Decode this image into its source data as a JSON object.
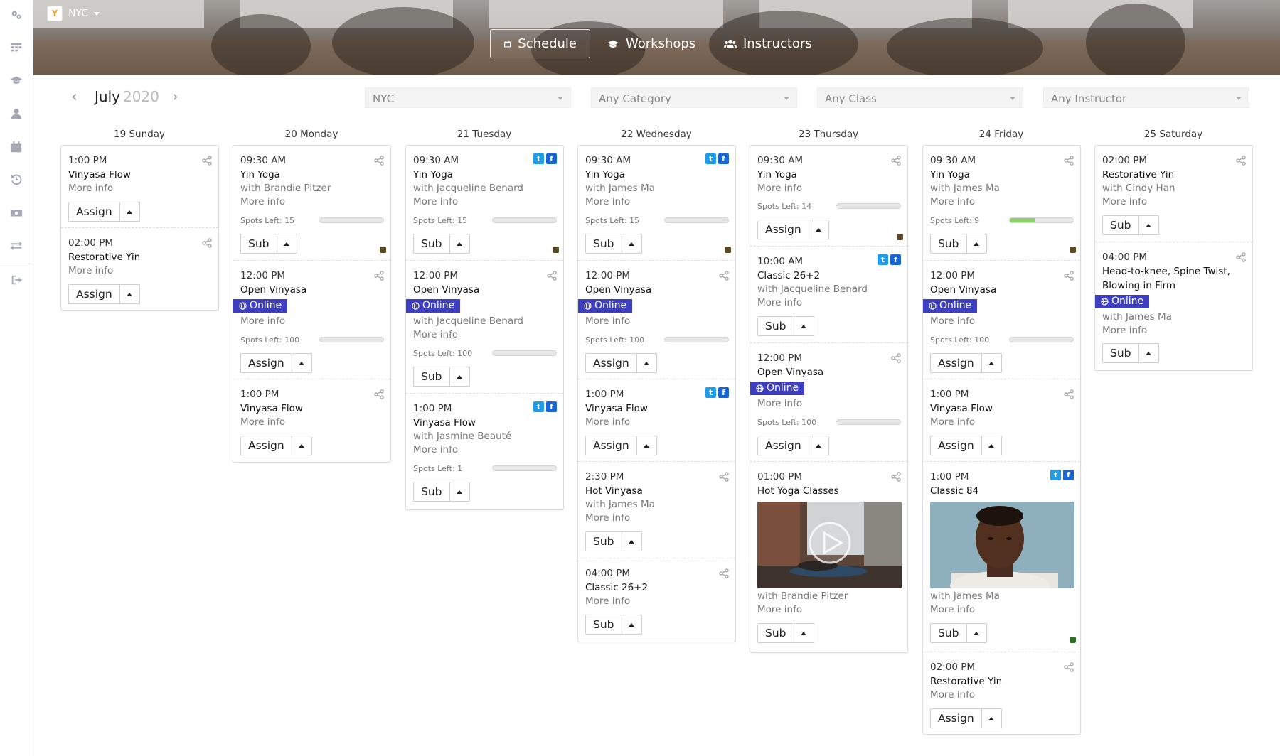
{
  "app": {
    "location": "NYC",
    "logo_text": "Y"
  },
  "nav": {
    "schedule": "Schedule",
    "workshops": "Workshops",
    "instructors": "Instructors"
  },
  "calendar": {
    "month": "July",
    "year": "2020",
    "prev": "‹",
    "next": "›"
  },
  "filters": {
    "location": "NYC",
    "category": "Any Category",
    "class": "Any Class",
    "instructor": "Any Instructor"
  },
  "days": [
    {
      "label": "19 Sunday",
      "classes": [
        {
          "time": "1:00 PM",
          "title": "Vinyasa Flow",
          "more": "More info",
          "action": "Assign"
        },
        {
          "time": "02:00 PM",
          "title": "Restorative Yin",
          "more": "More info",
          "action": "Assign"
        }
      ]
    },
    {
      "label": "20 Monday",
      "classes": [
        {
          "time": "09:30 AM",
          "title": "Yin Yoga",
          "instructor": "with Brandie Pitzer",
          "more": "More info",
          "spots": "Spots Left: 15",
          "spots_fill": 0,
          "action": "Sub"
        },
        {
          "time": "12:00 PM",
          "title": "Open Vinyasa",
          "online": "Online",
          "more": "More info",
          "spots": "Spots Left: 100",
          "spots_fill": 0,
          "action": "Assign"
        },
        {
          "time": "1:00 PM",
          "title": "Vinyasa Flow",
          "more": "More info",
          "action": "Assign"
        }
      ]
    },
    {
      "label": "21 Tuesday",
      "classes": [
        {
          "time": "09:30 AM",
          "title": "Yin Yoga",
          "instructor": "with Jacqueline Benard",
          "more": "More info",
          "spots": "Spots Left: 15",
          "spots_fill": 0,
          "action": "Sub"
        },
        {
          "time": "12:00 PM",
          "title": "Open Vinyasa",
          "online": "Online",
          "instructor": "with Jacqueline Benard",
          "more": "More info",
          "spots": "Spots Left: 100",
          "spots_fill": 0,
          "action": "Sub"
        },
        {
          "time": "1:00 PM",
          "title": "Vinyasa Flow",
          "instructor": "with Jasmine Beauté",
          "more": "More info",
          "spots": "Spots Left: 1",
          "spots_fill": 0,
          "action": "Sub"
        }
      ]
    },
    {
      "label": "22 Wednesday",
      "classes": [
        {
          "time": "09:30 AM",
          "title": "Yin Yoga",
          "instructor": "with James Ma",
          "more": "More info",
          "spots": "Spots Left: 15",
          "spots_fill": 0,
          "action": "Sub"
        },
        {
          "time": "12:00 PM",
          "title": "Open Vinyasa",
          "online": "Online",
          "more": "More info",
          "spots": "Spots Left: 100",
          "spots_fill": 0,
          "action": "Assign"
        },
        {
          "time": "1:00 PM",
          "title": "Vinyasa Flow",
          "more": "More info",
          "action": "Assign"
        },
        {
          "time": "2:30 PM",
          "title": "Hot Vinyasa",
          "instructor": "with James Ma",
          "more": "More info",
          "action": "Sub"
        },
        {
          "time": "04:00 PM",
          "title": "Classic 26+2",
          "more": "More info",
          "action": "Sub"
        }
      ]
    },
    {
      "label": "23 Thursday",
      "classes": [
        {
          "time": "09:30 AM",
          "title": "Yin Yoga",
          "more": "More info",
          "spots": "Spots Left: 14",
          "spots_fill": 0,
          "action": "Assign"
        },
        {
          "time": "10:00 AM",
          "title": "Classic 26+2",
          "instructor": "with Jacqueline Benard",
          "more": "More info",
          "action": "Sub"
        },
        {
          "time": "12:00 PM",
          "title": "Open Vinyasa",
          "online": "Online",
          "more": "More info",
          "spots": "Spots Left: 100",
          "spots_fill": 0,
          "action": "Assign"
        },
        {
          "time": "01:00 PM",
          "title": "Hot Yoga Classes",
          "instructor": "with Brandie Pitzer",
          "more": "More info",
          "action": "Sub"
        }
      ]
    },
    {
      "label": "24 Friday",
      "classes": [
        {
          "time": "09:30 AM",
          "title": "Yin Yoga",
          "instructor": "with James Ma",
          "more": "More info",
          "spots": "Spots Left: 9",
          "spots_fill": 0.4,
          "action": "Sub"
        },
        {
          "time": "12:00 PM",
          "title": "Open Vinyasa",
          "online": "Online",
          "more": "More info",
          "spots": "Spots Left: 100",
          "spots_fill": 0,
          "action": "Assign"
        },
        {
          "time": "1:00 PM",
          "title": "Vinyasa Flow",
          "more": "More info",
          "action": "Assign"
        },
        {
          "time": "1:00 PM",
          "title": "Classic 84",
          "instructor": "with James Ma",
          "more": "More info",
          "action": "Sub"
        },
        {
          "time": "02:00 PM",
          "title": "Restorative Yin",
          "more": "More info",
          "action": "Assign"
        }
      ]
    },
    {
      "label": "25 Saturday",
      "classes": [
        {
          "time": "02:00 PM",
          "title": "Restorative Yin",
          "instructor": "with Cindy Han",
          "more": "More info",
          "action": "Sub"
        },
        {
          "time": "04:00 PM",
          "title": "Head-to-knee, Spine Twist, Blowing in Firm",
          "online": "Online",
          "instructor": "with James Ma",
          "more": "More info",
          "action": "Sub"
        }
      ]
    }
  ],
  "colors": {
    "online": "#3d3ec0",
    "twitter": "#1e9be9",
    "facebook": "#1865d8",
    "progress": "#8ad36b"
  },
  "icons": {
    "share": "share-icon",
    "twitter": "twitter-icon",
    "facebook": "facebook-icon",
    "play": "play-icon"
  }
}
